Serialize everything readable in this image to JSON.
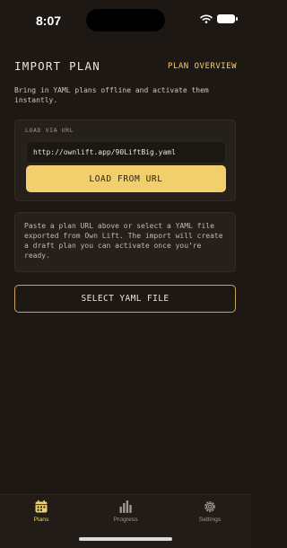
{
  "status_bar": {
    "time": "8:07"
  },
  "header": {
    "title": "IMPORT PLAN",
    "overview_link": "PLAN OVERVIEW"
  },
  "intro": "Bring in YAML plans offline and activate them instantly.",
  "url_card": {
    "label": "LOAD VIA URL",
    "url_value": "http://ownlift.app/90LiftBig.yaml",
    "load_button": "LOAD FROM URL"
  },
  "info_text": "Paste a plan URL above or select a YAML file exported from Own Lift. The import will create a draft plan you can activate once you’re ready.",
  "select_button": "SELECT YAML FILE",
  "tabs": [
    {
      "label": "Plans",
      "icon": "calendar-icon",
      "active": true
    },
    {
      "label": "Progress",
      "icon": "bar-chart-icon",
      "active": false
    },
    {
      "label": "Settings",
      "icon": "gear-icon",
      "active": false
    }
  ],
  "colors": {
    "accent": "#f2cf6d",
    "background": "#1d1814",
    "card": "#25201b"
  }
}
